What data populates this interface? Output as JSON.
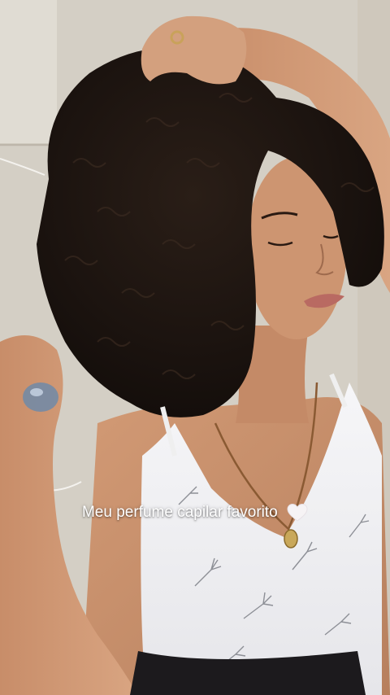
{
  "caption": {
    "text": "Meu perfume capilar favorito",
    "emoji": "white-heart-icon"
  },
  "colors": {
    "wall": "#d6d1c7",
    "hair": "#1c1410",
    "skin": "#c98f6b",
    "top": "#f1f1f3"
  }
}
